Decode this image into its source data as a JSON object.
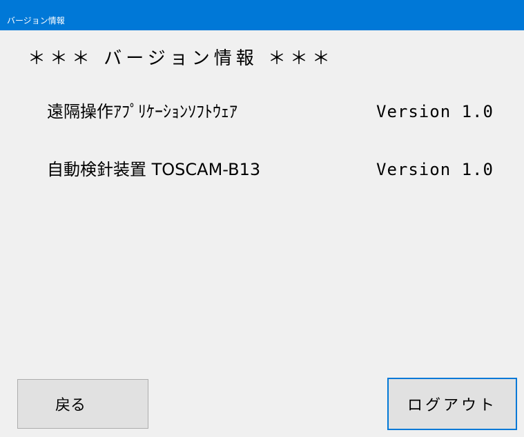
{
  "window": {
    "title": "バージョン情報"
  },
  "main": {
    "heading": "＊＊＊ バージョン情報 ＊＊＊",
    "rows": [
      {
        "label": "遠隔操作ｱﾌﾟﾘｹｰｼｮﾝｿﾌﾄｳｪｱ",
        "version": "Version 1.0"
      },
      {
        "label": "自動検針装置 TOSCAM-B13",
        "version": "Version 1.0"
      }
    ]
  },
  "buttons": {
    "back_label": "戻る",
    "logout_label": "ログアウト"
  },
  "colors": {
    "titlebar": "#0078d7",
    "background": "#f0f0f0",
    "focus_border": "#0078d7"
  }
}
